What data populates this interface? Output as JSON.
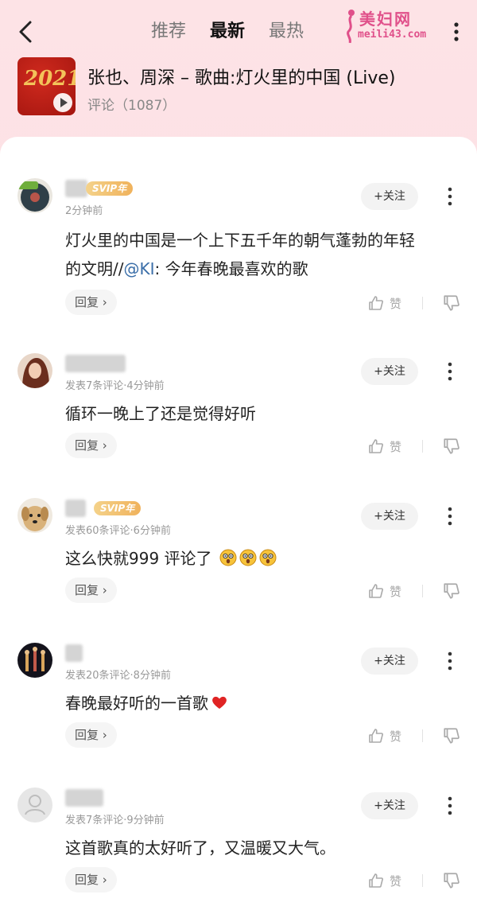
{
  "header": {
    "tabs": [
      {
        "label": "推荐",
        "active": false
      },
      {
        "label": "最新",
        "active": true
      },
      {
        "label": "最热",
        "active": false
      }
    ],
    "watermark": {
      "title": "美妇网",
      "url": "meili43.com"
    }
  },
  "song": {
    "title": "张也、周深 – 歌曲:灯火里的中国 (Live)",
    "comments_label": "评论",
    "comments_count": "（1087）",
    "cover_text": "2021"
  },
  "actions": {
    "follow": "+关注",
    "reply": "回复",
    "like": "赞"
  },
  "comments": [
    {
      "badge": "SVIP年",
      "meta": "2分钟前",
      "text_lines": [
        "灯火里的中国是一个上下五千年的朝气蓬勃的年轻",
        "的文明//"
      ],
      "mention": "@KI",
      "text_tail": ": 今年春晚最喜欢的歌"
    },
    {
      "badge": "",
      "meta": "发表7条评论·4分钟前",
      "text": "循环一晚上了还是觉得好听"
    },
    {
      "badge": "SVIP年",
      "meta": "发表60条评论·6分钟前",
      "text": "这么快就999 评论了"
    },
    {
      "badge": "",
      "meta": "发表20条评论·8分钟前",
      "text": "春晚最好听的一首歌"
    },
    {
      "badge": "",
      "meta": "发表7条评论·9分钟前",
      "text": "这首歌真的太好听了，又温暖又大气。"
    }
  ],
  "colors": {
    "accent": "#e0508a",
    "svip": "#f0b25c",
    "mention": "#3a6ea8",
    "heart": "#e02424"
  }
}
